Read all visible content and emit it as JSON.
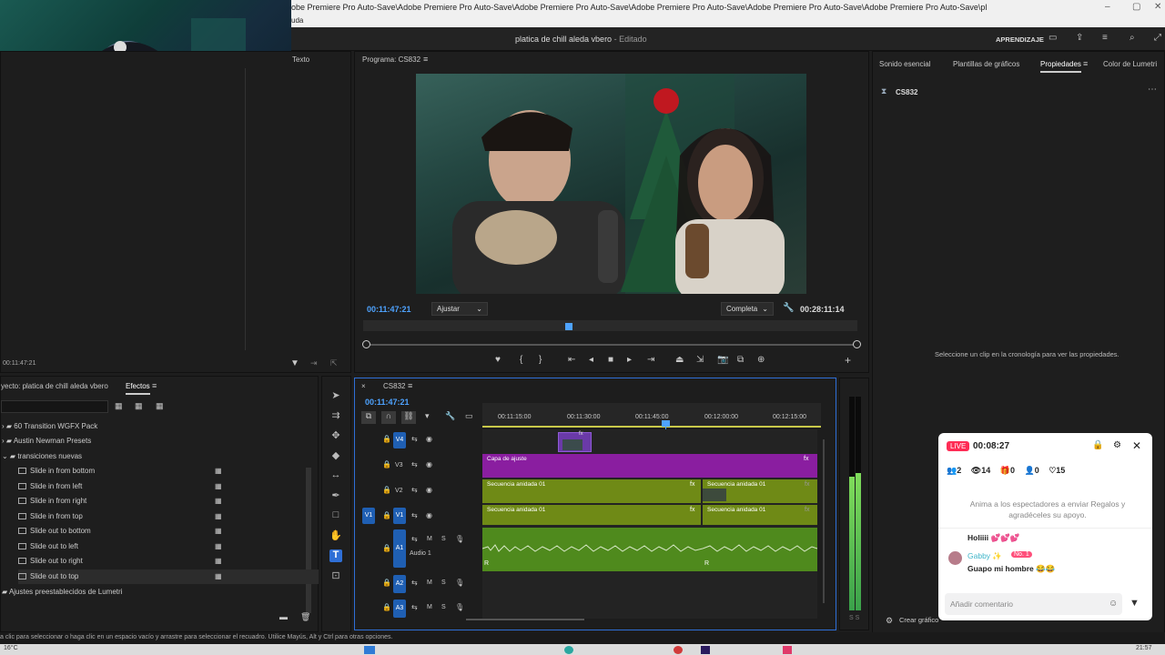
{
  "window": {
    "title_path": "obe Premiere Pro Auto-Save\\Adobe Premiere Pro Auto-Save\\Adobe Premiere Pro Auto-Save\\Adobe Premiere Pro Auto-Save\\Adobe Premiere Pro Auto-Save\\Adobe Premiere Pro Auto-Save\\pl",
    "menu_fragment": "uda"
  },
  "header": {
    "doc_title": "platica de chill aleda vbero",
    "doc_status": " - Editado",
    "workspace_label": "APRENDIZAJE"
  },
  "left_top": {
    "texto_tab": "Texto",
    "timecode": "00:11:47:21"
  },
  "program": {
    "tab_label": "Programa: CS832",
    "timecode_left": "00:11:47:21",
    "fit_option": "Ajustar",
    "resolution_option": "Completa",
    "timecode_right": "00:28:11:14"
  },
  "right_panel": {
    "tabs": [
      "Sonido esencial",
      "Plantillas de gráficos",
      "Propiedades",
      "Color de Lumetri"
    ],
    "seq_name": "CS832",
    "hint": "Seleccione un clip en la cronología para ver las propiedades.",
    "create_graphic": "Crear gráfico"
  },
  "project": {
    "title": "yecto: platica de chill aleda vbero",
    "effects_tab": "Efectos",
    "folders": [
      "60 Transition WGFX Pack",
      "Austin Newman Presets",
      "transiciones nuevas"
    ],
    "items": [
      "Slide in from bottom",
      "Slide in from left",
      "Slide in from right",
      "Slide in from top",
      "Slide out to bottom",
      "Slide out to left",
      "Slide out to right",
      "Slide out to top"
    ],
    "lumetri": "Ajustes preestablecidos de Lumetri"
  },
  "timeline": {
    "seq_tab": "CS832",
    "timecode": "00:11:47:21",
    "ruler": [
      "00:11:15:00",
      "00:11:30:00",
      "00:11:45:00",
      "00:12:00:00",
      "00:12:15:00"
    ],
    "video_tracks": [
      "V4",
      "V3",
      "V2",
      "V1"
    ],
    "source_v": "V1",
    "audio_tracks": [
      "A1",
      "A2",
      "A3"
    ],
    "audio1_name": "Audio 1",
    "m_label": "M",
    "s_label": "S",
    "clip_adjust": "Capa de ajuste",
    "clip_nested": "Secuencia anidada 01",
    "fx": "fx",
    "r_label": "R"
  },
  "meters": {
    "label": "S S"
  },
  "live": {
    "badge": "LIVE",
    "timer": "00:08:27",
    "stats": [
      "2",
      "14",
      "0",
      "0",
      "15"
    ],
    "prompt": "Anima a los espectadores a enviar Regalos y agradéceles su apoyo.",
    "messages": [
      {
        "user": "",
        "text": "Holiiii 💕💕💕"
      },
      {
        "user": "Gabby ✨",
        "badge": "No. 1",
        "text": "Guapo mi hombre 😂😂"
      }
    ],
    "comment_placeholder": "Añadir comentario"
  },
  "status": {
    "text": "a clic para seleccionar o haga clic en un espacio vacío y arrastre para seleccionar el recuadro. Utilice Mayús, Alt y Ctrl para otras opciones."
  },
  "taskbar": {
    "weather": "16°C",
    "clock": "21:57"
  },
  "colors": {
    "timecode_blue": "#4ea3ff",
    "adjust_clip": "#8a1ea0",
    "nested_clip": "#6f8a16",
    "audio_clip": "#4f8a1d",
    "live_red": "#fe2c55"
  }
}
